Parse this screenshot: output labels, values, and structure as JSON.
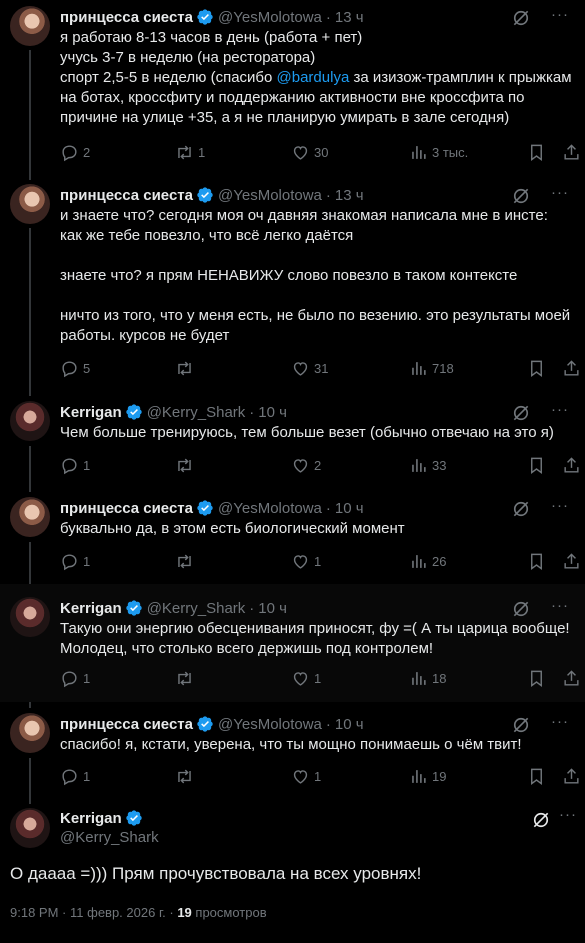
{
  "tweets": [
    {
      "name": "принцесса сиеста",
      "handle": "@YesMolotowa",
      "dot": "·",
      "time": "13 ч",
      "text_before": "я работаю 8-13 часов в день (работа + пет)\nучусь 3-7 в неделю (на ресторатора)\nспорт 2,5-5 в неделю (спасибо ",
      "mention": "@bardulya",
      "text_after": " за изизож-трамплин к прыжкам на ботах, кроссфиту и поддержанию активности вне кроссфита по причине на улице +35, а я не планирую умирать в зале сегодня)",
      "replies": "2",
      "retweets": "1",
      "likes": "30",
      "views": "3 тыс."
    },
    {
      "name": "принцесса сиеста",
      "handle": "@YesMolotowa",
      "dot": "·",
      "time": "13 ч",
      "text": "и знаете что? сегодня моя оч давняя знакомая написала мне в инсте: как же тебе повезло, что всё легко даётся\n\nзнаете что? я прям НЕНАВИЖУ слово повезло в таком контексте\n\nничто из того, что у меня есть, не было по везению. это результаты моей работы. курсов не будет",
      "replies": "5",
      "retweets": "",
      "likes": "31",
      "views": "718"
    },
    {
      "name": "Kerrigan",
      "handle": "@Kerry_Shark",
      "dot": "·",
      "time": "10 ч",
      "text": "Чем больше тренируюсь, тем больше везет (обычно отвечаю на это я)",
      "replies": "1",
      "retweets": "",
      "likes": "2",
      "views": "33"
    },
    {
      "name": "принцесса сиеста",
      "handle": "@YesMolotowa",
      "dot": "·",
      "time": "10 ч",
      "text": "буквально да, в этом есть биологический момент",
      "replies": "1",
      "retweets": "",
      "likes": "1",
      "views": "26"
    },
    {
      "name": "Kerrigan",
      "handle": "@Kerry_Shark",
      "dot": "·",
      "time": "10 ч",
      "text": "Такую они энергию обесценивания приносят, фу =( А ты царица вообще! Молодец, что столько всего держишь под контролем!",
      "replies": "1",
      "retweets": "",
      "likes": "1",
      "views": "18"
    },
    {
      "name": "принцесса сиеста",
      "handle": "@YesMolotowa",
      "dot": "·",
      "time": "10 ч",
      "text": "спасибо! я, кстати, уверена, что ты мощно понимаешь о чём твит!",
      "replies": "1",
      "retweets": "",
      "likes": "1",
      "views": "19"
    }
  ],
  "main": {
    "name": "Kerrigan",
    "handle": "@Kerry_Shark",
    "text": "О даааа =))) Прям прочувствовала на всех уровнях!",
    "time": "9:18 PM",
    "dot": "·",
    "date": "11 февр. 2026 г.",
    "views_count": "19",
    "views_label": "просмотров"
  },
  "more_glyph": "···",
  "colors": {
    "background": "#000000",
    "text": "#e7e9ea",
    "muted": "#71767b",
    "accent": "#1d9bf0",
    "thread_line": "#333639"
  }
}
